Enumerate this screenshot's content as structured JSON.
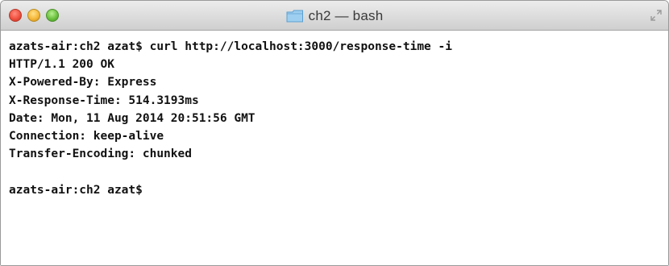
{
  "window": {
    "title": "ch2 — bash",
    "controls": {
      "close_color": "#f0503f",
      "minimize_color": "#f5b83a",
      "zoom_color": "#6cc13f"
    },
    "icons": {
      "title_icon": "folder-icon",
      "fullscreen": "fullscreen-arrows-icon"
    }
  },
  "terminal": {
    "lines": [
      "azats-air:ch2 azat$ curl http://localhost:3000/response-time -i",
      "HTTP/1.1 200 OK",
      "X-Powered-By: Express",
      "X-Response-Time: 514.3193ms",
      "Date: Mon, 11 Aug 2014 20:51:56 GMT",
      "Connection: keep-alive",
      "Transfer-Encoding: chunked",
      "",
      "azats-air:ch2 azat$ "
    ]
  }
}
